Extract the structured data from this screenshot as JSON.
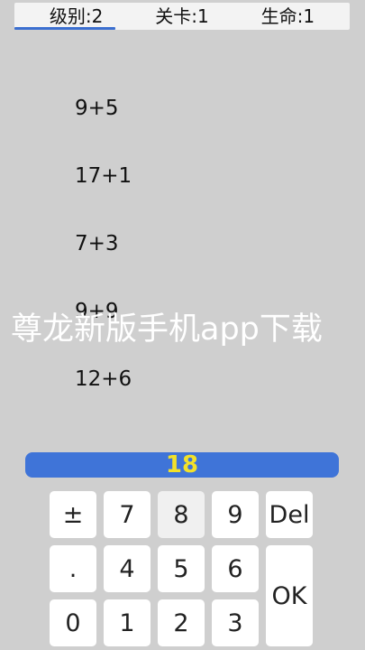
{
  "status": {
    "level_label": "级别:2",
    "stage_label": "关卡:1",
    "lives_label": "生命:1",
    "progress_fraction": 0.3
  },
  "questions": [
    "9+5",
    "17+1",
    "7+3",
    "9+9",
    "12+6"
  ],
  "watermark": "尊龙新版手机app下载",
  "answer": {
    "value": "18"
  },
  "keypad": {
    "keys": [
      "±",
      "7",
      "8",
      "9",
      "Del",
      ".",
      "4",
      "5",
      "6",
      "OK",
      "0",
      "1",
      "2",
      "3"
    ]
  },
  "colors": {
    "background": "#cfcfcf",
    "accent_blue": "#3f74d8",
    "answer_text": "#f2e12a"
  }
}
